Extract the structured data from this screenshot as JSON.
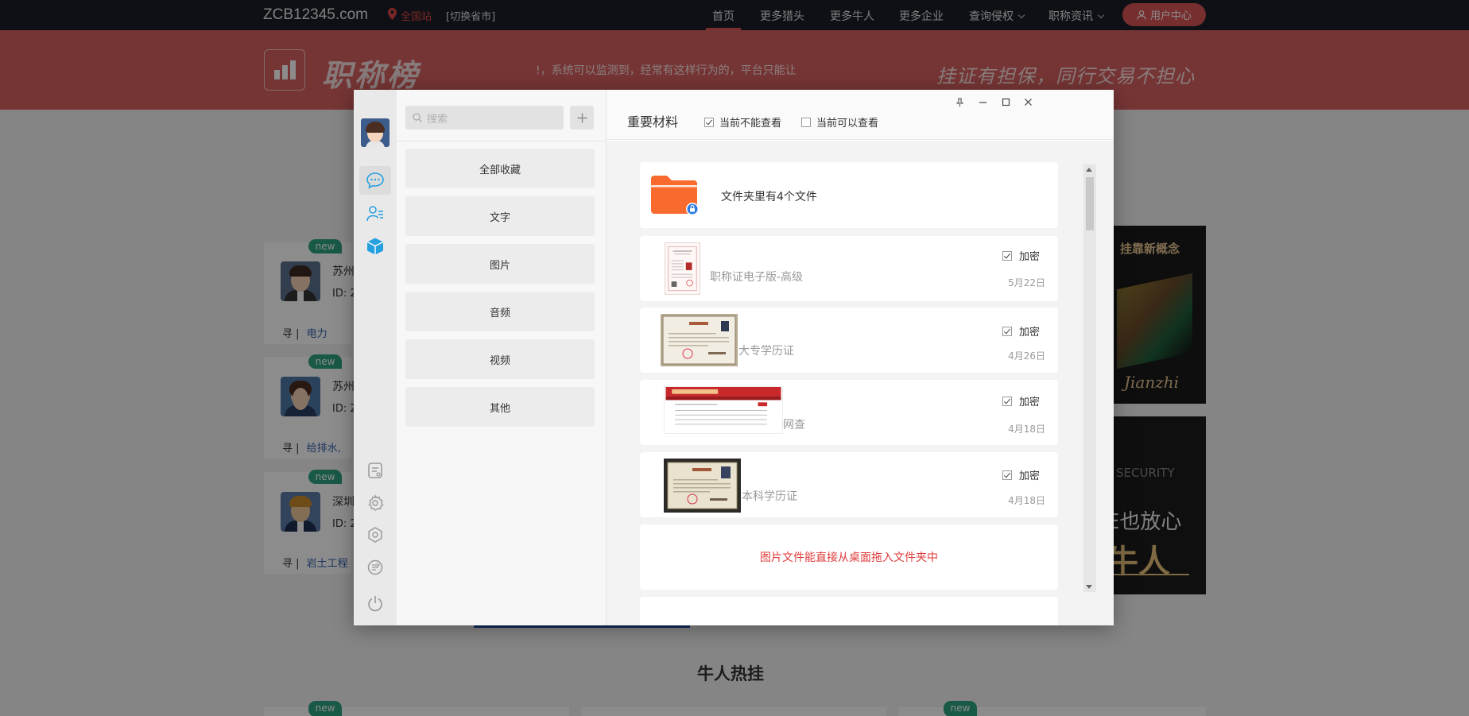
{
  "site": {
    "brand": "ZCB12345.com",
    "location": "全国站",
    "switch_province": "[切换省市]",
    "nav": [
      "首页",
      "更多猎头",
      "更多牛人",
      "更多企业",
      "查询侵权",
      "职称资讯"
    ],
    "user_center": "用户中心",
    "logo_text": "职称榜",
    "marquee": "!，系统可以监测到，经常有这样行为的，平台只能让",
    "slogan": "挂证有担保，同行交易不担心",
    "hot_title": "牛人热挂",
    "cards": [
      {
        "tag": "new",
        "name": "苏州",
        "id": "ID: 2",
        "label": "寻",
        "field": "电力"
      },
      {
        "tag": "new",
        "name": "苏州",
        "id": "ID: 2",
        "label": "寻",
        "field": "给排水,"
      },
      {
        "tag": "new",
        "name": "深圳",
        "id": "ID: 2",
        "label": "寻",
        "field": "岩土工程"
      }
    ],
    "bottom_tags": [
      "new",
      "new"
    ],
    "ad1": {
      "title": "挂靠新概念",
      "script": "Jianzhi"
    },
    "ad2": {
      "line1": "SECURITY",
      "line2": "E也放心",
      "line3": "牛人"
    },
    "accent": "#d86161"
  },
  "modal": {
    "search_placeholder": "搜索",
    "categories": [
      "全部收藏",
      "文字",
      "图片",
      "音频",
      "视频",
      "其他"
    ],
    "title": "重要材料",
    "filter_cannot_view": "当前不能查看",
    "filter_can_view": "当前可以查看",
    "filter_cannot_view_checked": true,
    "filter_can_view_checked": false,
    "folder_text": "文件夹里有4个文件",
    "lock_label": "加密",
    "files": [
      {
        "name": "职称证电子版-高级",
        "date": "5月22日",
        "encrypted": true
      },
      {
        "name": "大专学历证",
        "date": "4月26日",
        "encrypted": true
      },
      {
        "name": "网查",
        "date": "4月18日",
        "encrypted": true
      },
      {
        "name": "本科学历证",
        "date": "4月18日",
        "encrypted": true
      }
    ],
    "drop_hint": "图片文件能直接从桌面拖入文件夹中",
    "accent_blue": "#27a0e0",
    "folder_color": "#f96a2e",
    "hint_color": "#e03b3b"
  },
  "icons": [
    "location-pin-icon",
    "user-icon",
    "chat-icon",
    "contacts-icon",
    "cube-icon",
    "notes-icon",
    "gear-icon",
    "settings-icon",
    "share-icon",
    "power-icon",
    "search-icon",
    "plus-icon",
    "pin-icon",
    "minimize-icon",
    "maximize-icon",
    "close-icon",
    "folder-icon",
    "lock-icon"
  ]
}
